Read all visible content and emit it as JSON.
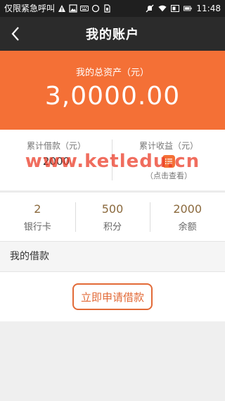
{
  "status_bar": {
    "carrier": "仅限紧急呼叫",
    "time": "11:48",
    "left_icons": [
      "warning-icon",
      "image-icon",
      "keyboard-icon",
      "circle-icon",
      "sim-icon"
    ],
    "right_icons": [
      "mute-icon",
      "wifi-icon",
      "data-saver-icon",
      "battery-icon"
    ]
  },
  "navbar": {
    "title": "我的账户",
    "back_icon": "chevron-left-icon"
  },
  "hero": {
    "label": "我的总资产（元）",
    "amount": "3,0000.00",
    "color": "#f47036"
  },
  "summary": {
    "loan_label": "累计借款（元）",
    "loan_value": "2000",
    "income_label": "累计收益（元）",
    "income_icon": "list-icon",
    "income_hint": "（点击查看）"
  },
  "watermark": "www.ketledu.cn",
  "stats": [
    {
      "value": "2",
      "label": "银行卡"
    },
    {
      "value": "500",
      "label": "积分"
    },
    {
      "value": "2000",
      "label": "余额"
    }
  ],
  "section": {
    "title": "我的借款"
  },
  "apply_button": {
    "label": "立即申请借款",
    "color": "#e26a37"
  }
}
